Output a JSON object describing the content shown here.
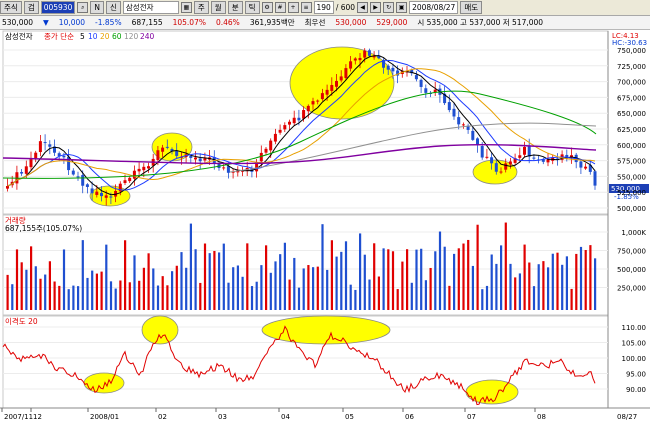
{
  "toolbar": {
    "market_label": "주식",
    "search_label": "검",
    "code_value": "005930",
    "n_label": "N",
    "sin_label": "신",
    "stock_name": "삼성전자",
    "period_buttons": [
      "주",
      "월",
      "분",
      "틱"
    ],
    "count_value": "190",
    "max_count": "/ 600",
    "date_value": "2008/08/27",
    "buy_label": "매도"
  },
  "quote": {
    "price": "530,000",
    "change_arrow": "▼",
    "change": "10,000",
    "change_pct": "-1.85%",
    "volume": "687,155",
    "volume_pct": "105.07%",
    "ratio": "0.46%",
    "amount": "361,935백만",
    "best_label": "최우선",
    "best_sell": "530,000",
    "best_buy": "529,000",
    "ohlc": "시 535,000 고 537,000 저 517,000"
  },
  "price_panel": {
    "title": "삼성전자",
    "ma_label": "종가 단순",
    "ma_periods": [
      "5",
      "10",
      "20",
      "60",
      "120",
      "240"
    ],
    "lc_label": "LC:4.13",
    "hc_label": "HC:-30.63",
    "current_price": "530,000",
    "current_pct": "-1.85%",
    "y_ticks": [
      "750,000",
      "725,000",
      "700,000",
      "675,000",
      "650,000",
      "625,000",
      "600,000",
      "575,000",
      "550,000",
      "525,000",
      "500,000"
    ]
  },
  "volume_panel": {
    "title": "거래량",
    "value_text": "687,155주(105.07%)",
    "y_ticks": [
      "1,000K",
      "750,000",
      "500,000",
      "250,000"
    ]
  },
  "disparity_panel": {
    "title": "이격도 20",
    "y_ticks": [
      "110.00",
      "105.00",
      "100.00",
      "95.00",
      "90.00"
    ]
  },
  "x_axis": {
    "labels": [
      "2007/11",
      "12",
      "2008/01",
      "02",
      "03",
      "04",
      "05",
      "06",
      "07",
      "08",
      "08/27"
    ]
  },
  "colors": {
    "up": "#e00000",
    "down": "#1f4fd0",
    "highlight": "#ffff00",
    "ma5": "#000000",
    "ma10": "#1e3cff",
    "ma20": "#e8a000",
    "ma60": "#00a000",
    "ma120": "#909090",
    "ma240": "#8000a0"
  }
}
